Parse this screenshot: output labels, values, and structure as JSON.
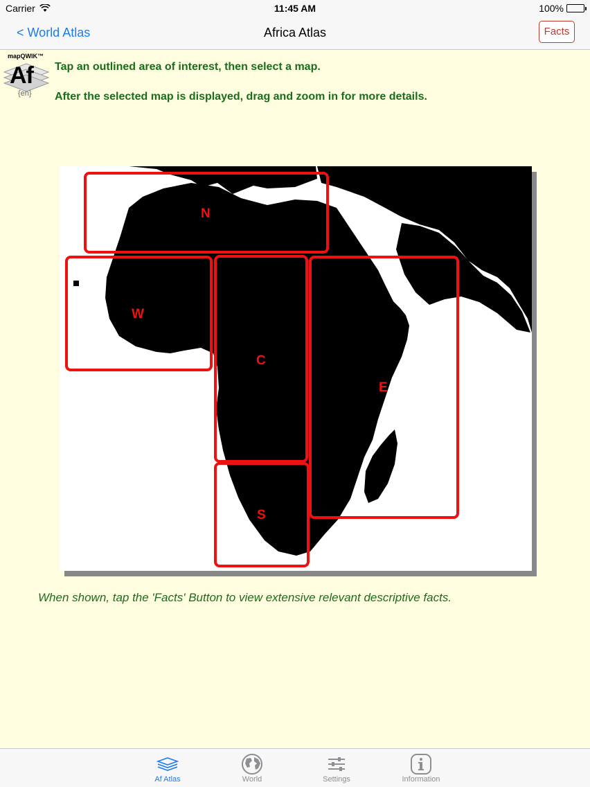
{
  "status": {
    "carrier": "Carrier",
    "time": "11:45 AM",
    "battery": "100%"
  },
  "nav": {
    "back_label": "< World Atlas",
    "title": "Africa Atlas",
    "facts_label": "Facts"
  },
  "logo": {
    "brand": "mapQWIK™",
    "text": "Af",
    "lang": "{en}"
  },
  "instructions": {
    "line1": "Tap an outlined area of interest, then select a map.",
    "line2": "After the selected map is displayed, drag and zoom in for more details."
  },
  "regions": [
    {
      "id": "N",
      "label": "N"
    },
    {
      "id": "W",
      "label": "W"
    },
    {
      "id": "C",
      "label": "C"
    },
    {
      "id": "E",
      "label": "E"
    },
    {
      "id": "S",
      "label": "S"
    }
  ],
  "footer_note": "When shown, tap the 'Facts' Button to view extensive relevant descriptive facts.",
  "tabs": [
    {
      "label": "Af Atlas",
      "icon": "layers-icon",
      "active": true
    },
    {
      "label": "World",
      "icon": "globe-icon",
      "active": false
    },
    {
      "label": "Settings",
      "icon": "sliders-icon",
      "active": false
    },
    {
      "label": "Information",
      "icon": "info-icon",
      "active": false
    }
  ],
  "colors": {
    "accent": "#1a7cf0",
    "region_outline": "#ee1111",
    "instruction_text": "#1b6d1b",
    "background": "#fffde0"
  }
}
